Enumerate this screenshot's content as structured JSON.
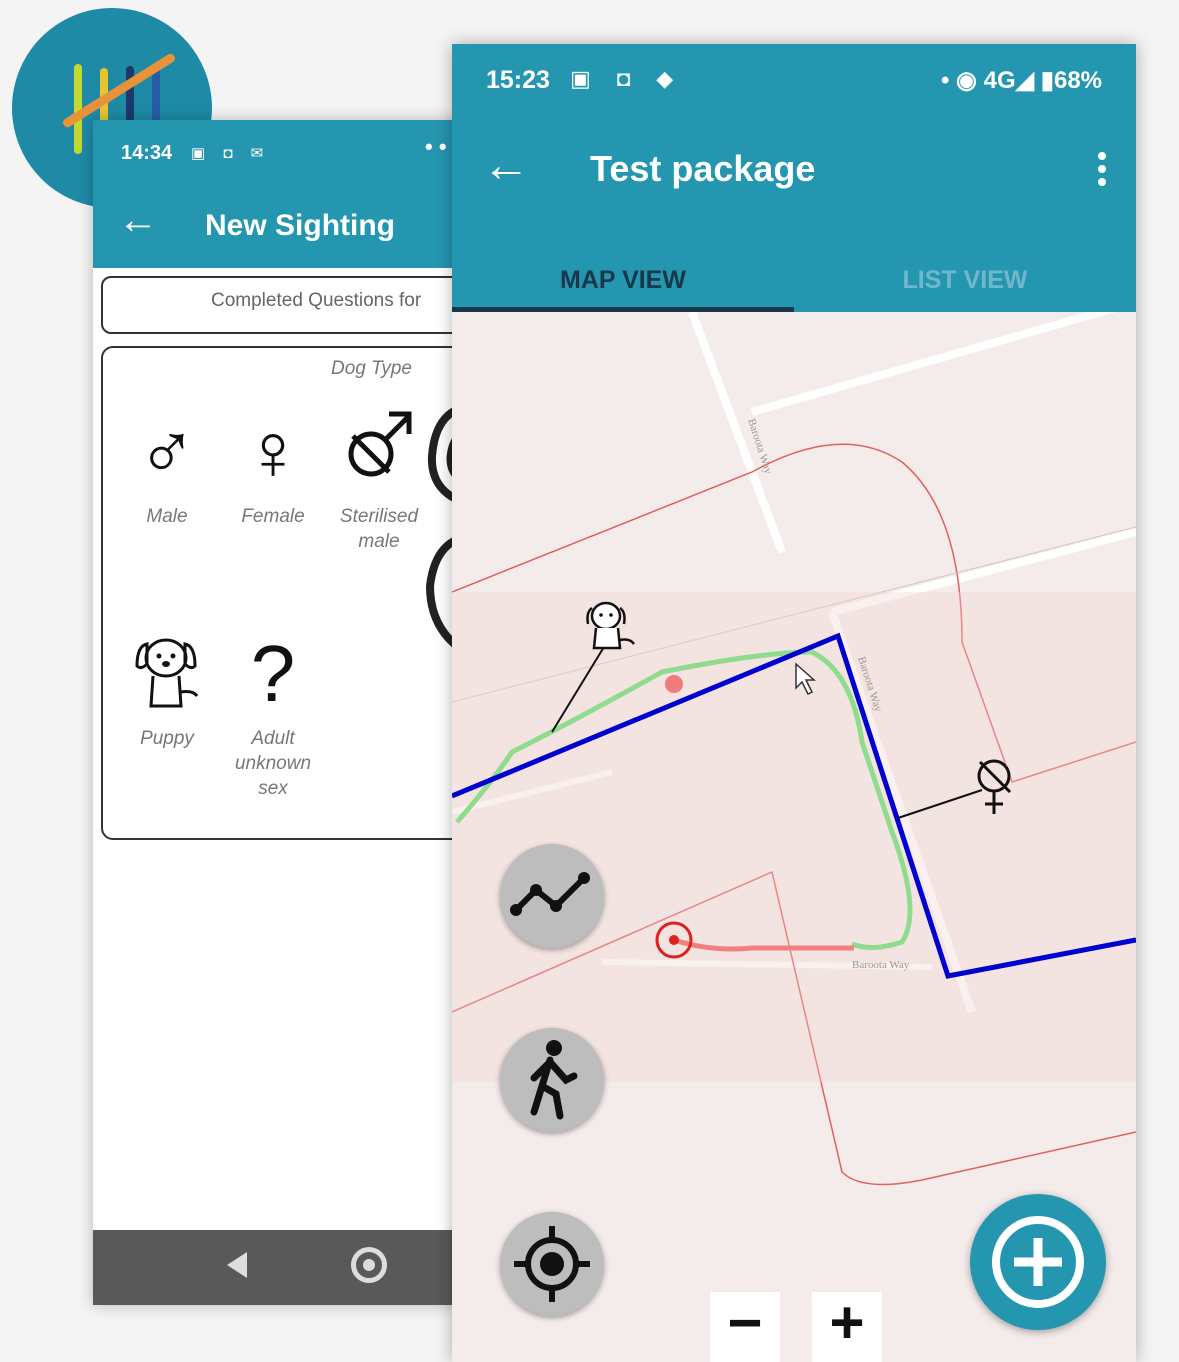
{
  "back_phone": {
    "status": {
      "time": "14:34",
      "icons": "▣ ◘ ✉",
      "dots": "• •"
    },
    "app_bar": {
      "back_arrow": "←",
      "title": "New Sighting"
    },
    "completed_label": "Completed Questions for",
    "dog_type": {
      "label": "Dog Type",
      "options": [
        {
          "symbol": "♂",
          "label": "Male"
        },
        {
          "symbol": "♀",
          "label": "Female"
        },
        {
          "symbol": "",
          "label": "Sterilised male"
        },
        {
          "symbol": "",
          "label": "Puppy"
        },
        {
          "symbol": "?",
          "label": "Adult unknown sex"
        }
      ]
    }
  },
  "front_phone": {
    "status": {
      "time": "15:23",
      "icons": "▣ ◘ ◆",
      "right": "• ◉ 4G◢ ▮68%"
    },
    "app_bar": {
      "back_arrow": "←",
      "title": "Test package"
    },
    "tabs": [
      {
        "label": "MAP VIEW",
        "active": true
      },
      {
        "label": "LIST VIEW",
        "active": false
      }
    ],
    "map": {
      "street_labels": [
        "Baroota Way",
        "Baroota Way",
        "Baroota Way"
      ],
      "controls": [
        "tracks-button",
        "walk-button",
        "locate-button"
      ],
      "zoom_out": "−",
      "zoom_in": "+"
    }
  },
  "colors": {
    "primary": "#2596b0",
    "route": "#0000d0",
    "track_green": "#8fdc8f",
    "track_red": "#f08080",
    "boundary": "#e06060"
  }
}
